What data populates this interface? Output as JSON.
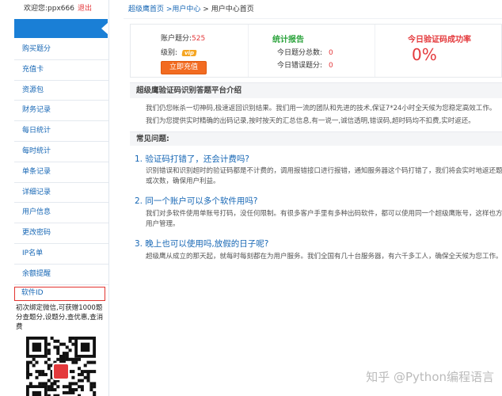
{
  "sidebar": {
    "welcome": "欢迎您:ppx666",
    "logout": "退出",
    "items": [
      "购买题分",
      "充值卡",
      "资源包",
      "财务记录",
      "每日统计",
      "每时统计",
      "单条记录",
      "详细记录",
      "用户信息",
      "更改密码",
      "IP名单",
      "余额提醒"
    ],
    "software_id": "软件ID",
    "promo": "初次绑定微信,可获赠1000题分查题分,设题分,查优惠,查消费"
  },
  "breadcrumb": {
    "home": "超级鹰首页",
    "sep1": " >",
    "user_center": "用户中心",
    "sep2": " > ",
    "current": "用户中心首页"
  },
  "stats": {
    "account_label": "账户题分:",
    "account_value": "525",
    "level_label": "级别:",
    "level_badge": "vip",
    "recharge_button": "立即充值",
    "report_title": "统计报告",
    "total_label": "今日题分总数:",
    "total_value": "0",
    "error_label": "今日错误题分:",
    "error_value": "0",
    "success_title": "今日验证码成功率",
    "success_value": "0%"
  },
  "intro": {
    "title": "超级鹰验证码识别答题平台介绍",
    "line1": "我们仍您帐杀一切神码,极速返回识别结果。我们用一流的团队和先进的技术,保证7*24小时全天候为您稳定高效工作。",
    "line2": "我们为您提供实时精确的出码记录,按时按天的汇总信息,有一说一,诚信透明,错误码,超时码均不扣费,实时返还。"
  },
  "faq": {
    "title": "常见问题:",
    "q1": "1. 验证码打错了，还会计费吗?",
    "a1a": "识别错误和识别超时的验证码都是不计费的，调用报错接口进行报错，通知服务器这个码打错了，我们将会实时地返还题",
    "a1b": "或次数，确保用户利益。",
    "q2": "2. 同一个账户可以多个软件用吗?",
    "a2a": "我们对多软件使用单账号打码，没任何限制。有很多客户手里有多种出码软件，都可以使用同一个超级鹰账号，这样也方",
    "a2b": "用户管理。",
    "q3": "3. 晚上也可以使用吗,放假的日子呢?",
    "a3": "超级鹰从成立的那天起，就每时每刻都在为用户服务。我们全国有几十台服务器，有六千多工人，确保全天候为您工作。"
  },
  "watermark": "知乎 @Python编程语言",
  "colors": {
    "accent": "#1a7fd6",
    "link": "#1767b5",
    "red": "#e4393c",
    "green": "#2aa33b",
    "orange": "#f26b21"
  }
}
